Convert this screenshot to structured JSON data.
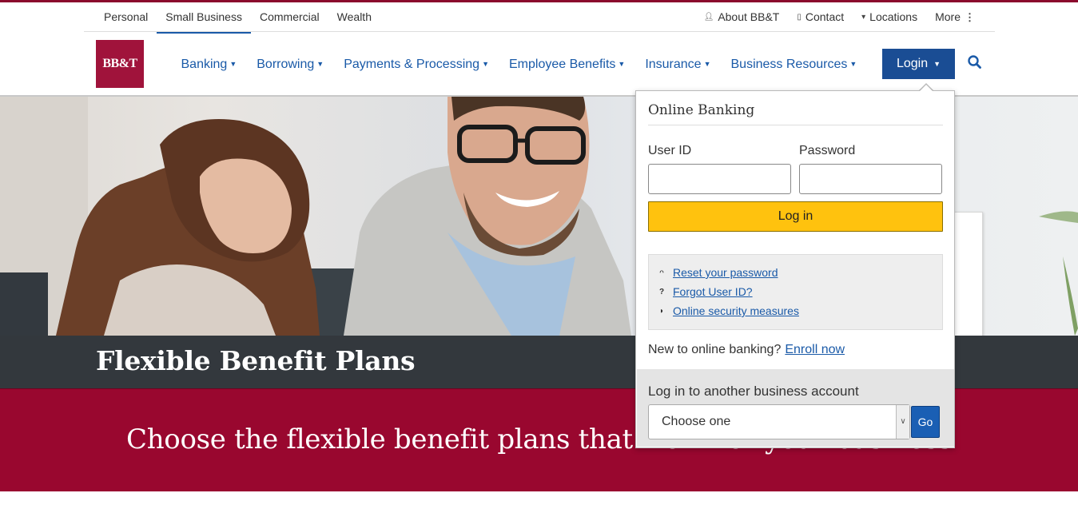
{
  "segment_tabs": [
    {
      "label": "Personal"
    },
    {
      "label": "Small Business"
    },
    {
      "label": "Commercial"
    },
    {
      "label": "Wealth"
    }
  ],
  "utility_links": [
    {
      "label": "About BB&T",
      "icon": "person-icon"
    },
    {
      "label": "Contact",
      "icon": "phone-icon"
    },
    {
      "label": "Locations",
      "icon": "map-pin-icon"
    },
    {
      "label": "More",
      "icon": "kebab-icon"
    }
  ],
  "logo": {
    "text": "BB&T",
    "color": "#a0133b"
  },
  "main_nav": [
    {
      "label": "Banking"
    },
    {
      "label": "Borrowing"
    },
    {
      "label": "Payments & Processing"
    },
    {
      "label": "Employee Benefits"
    },
    {
      "label": "Insurance"
    },
    {
      "label": "Business Resources"
    }
  ],
  "login_button": {
    "label": "Login"
  },
  "login_panel": {
    "heading": "Online Banking",
    "user_id_label": "User ID",
    "password_label": "Password",
    "submit_label": "Log in",
    "help_links": [
      {
        "label": "Reset your password",
        "icon": "key-icon"
      },
      {
        "label": "Forgot User ID?",
        "icon": "question-icon"
      },
      {
        "label": "Online security measures",
        "icon": "shield-icon"
      }
    ],
    "enroll_prompt": "New to online banking?",
    "enroll_link": "Enroll now",
    "other_account_label": "Log in to another business account",
    "account_select_value": "Choose one",
    "go_label": "Go"
  },
  "hero": {
    "title": "Flexible Benefit Plans"
  },
  "promo": {
    "text": "Choose the flexible benefit plans that work for your business"
  },
  "colors": {
    "brand": "#a0133b",
    "link": "#1a5aa8",
    "login": "#1a4d94",
    "submit": "#ffc20e",
    "title_band": "#33383d",
    "promo_band": "#99072f"
  }
}
